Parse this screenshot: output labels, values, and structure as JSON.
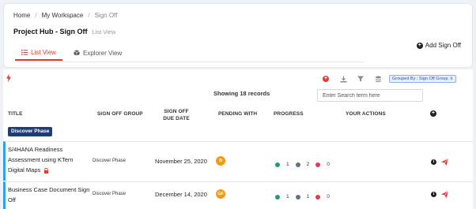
{
  "breadcrumb": {
    "items": [
      "Home",
      "My Workspace",
      "Sign Off"
    ]
  },
  "page": {
    "title": "Project Hub - Sign Off",
    "subtitle": "List View"
  },
  "tabs": [
    {
      "label": "List View",
      "active": true,
      "icon": "list-icon"
    },
    {
      "label": "Explorer View",
      "active": false,
      "icon": "cube-icon"
    }
  ],
  "header_actions": {
    "add_label": "Add Sign Off"
  },
  "toolbar": {
    "icons": [
      "add-icon",
      "download-icon",
      "filter-icon",
      "layers-icon"
    ],
    "group_badge": "Grouped By : Sign Off Group",
    "group_badge_close": "x"
  },
  "list": {
    "showing": "Showing 18 records",
    "search_placeholder": "Enter Search term here"
  },
  "columns": {
    "title": "Title",
    "group": "Sign Off Group",
    "due": "Sign Off Due Date",
    "pending": "Pending With",
    "progress": "Progress",
    "actions": "Your Actions"
  },
  "groups": [
    {
      "label": "Discover Phase",
      "rows": [
        {
          "title": "S/4HANA Readiness Assessment using KTern Digital Maps",
          "group": "Discover Phase",
          "due": "November 25, 2020",
          "pending_initials": "B",
          "progress": {
            "green": "1",
            "gray": "2",
            "red": "0"
          },
          "locked": true
        },
        {
          "title": "Business Case Document Sign Off",
          "group": "Discover Phase",
          "due": "December 14, 2020",
          "pending_initials": "GF",
          "progress": {
            "green": "1",
            "gray": "1",
            "red": "0"
          },
          "locked": false
        }
      ]
    }
  ],
  "colors": {
    "accent": "#d6402b",
    "phase_badge": "#1e3d73",
    "row_marker": "#2ea0e8",
    "avatar": "#f39c12",
    "progress_green": "#1e9e6a",
    "progress_gray": "#5f7385",
    "progress_red": "#e53950"
  }
}
